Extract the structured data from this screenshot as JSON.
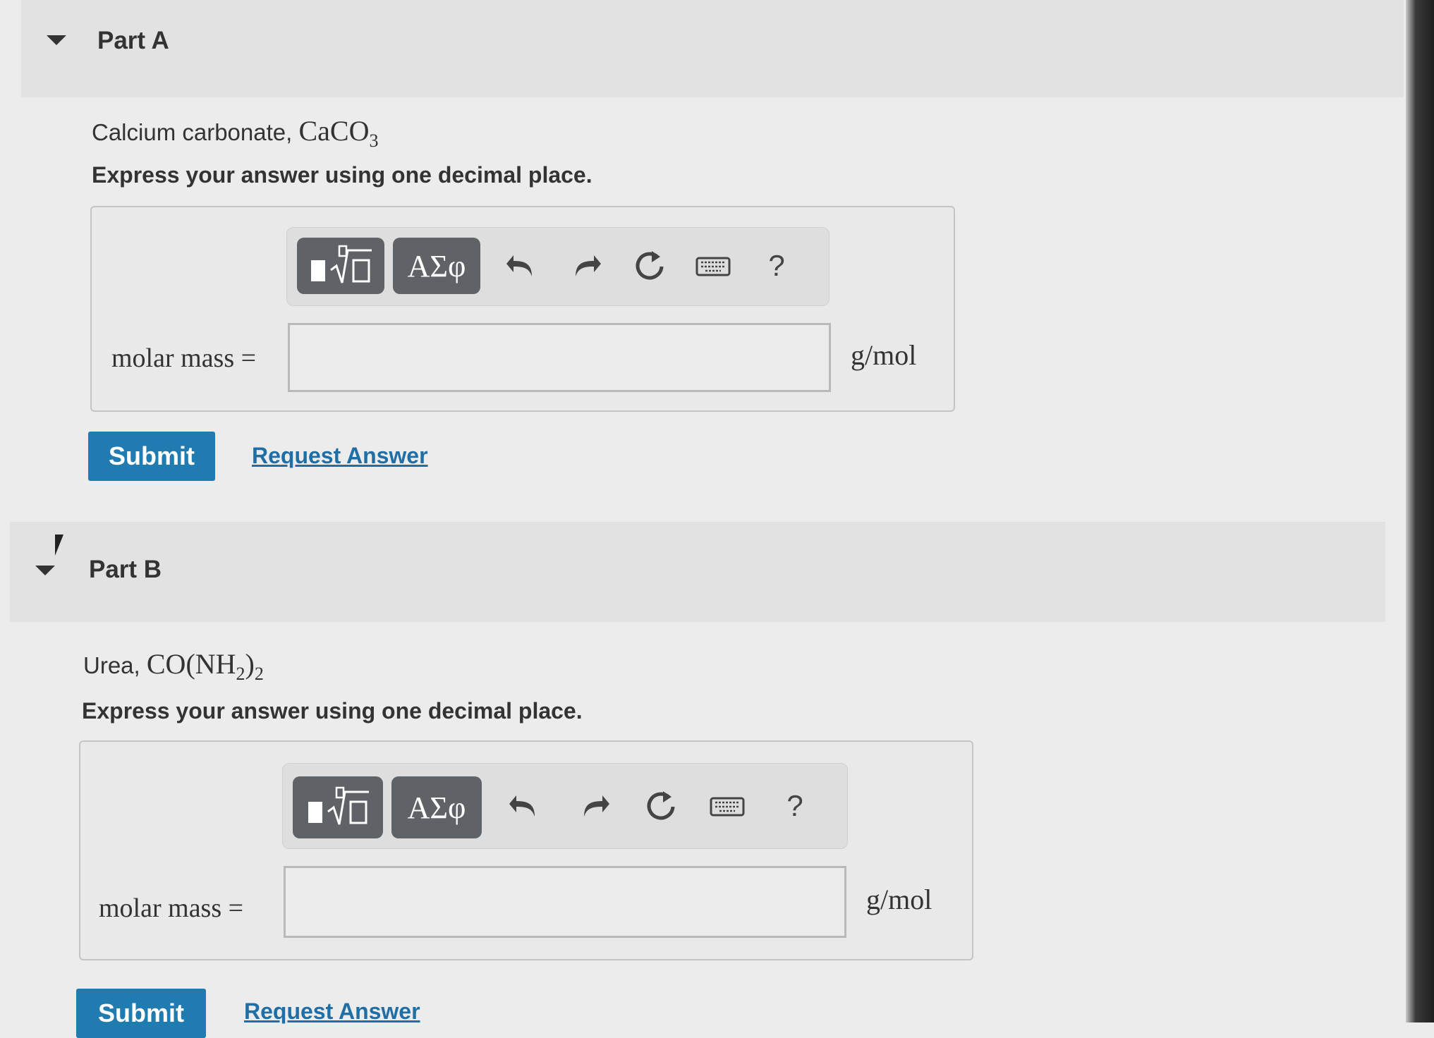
{
  "part_a": {
    "title": "Part A",
    "question_text": "Calcium carbonate, ",
    "formula": "CaCO",
    "formula_sub": "3",
    "instruction": "Express your answer using one decimal place.",
    "toolbar": {
      "greek_label": "ΑΣφ",
      "help_label": "?"
    },
    "input_label": "molar mass =",
    "input_value": "",
    "unit": "g/mol",
    "submit_label": "Submit",
    "request_label": "Request Answer"
  },
  "part_b": {
    "title": "Part B",
    "question_text": "Urea, ",
    "formula_pre": "CO(NH",
    "formula_sub1": "2",
    "formula_mid": ")",
    "formula_sub2": "2",
    "instruction": "Express your answer using one decimal place.",
    "toolbar": {
      "greek_label": "ΑΣφ",
      "help_label": "?"
    },
    "input_label": "molar mass =",
    "input_value": "",
    "unit": "g/mol",
    "submit_label": "Submit",
    "request_label": "Request Answer"
  }
}
